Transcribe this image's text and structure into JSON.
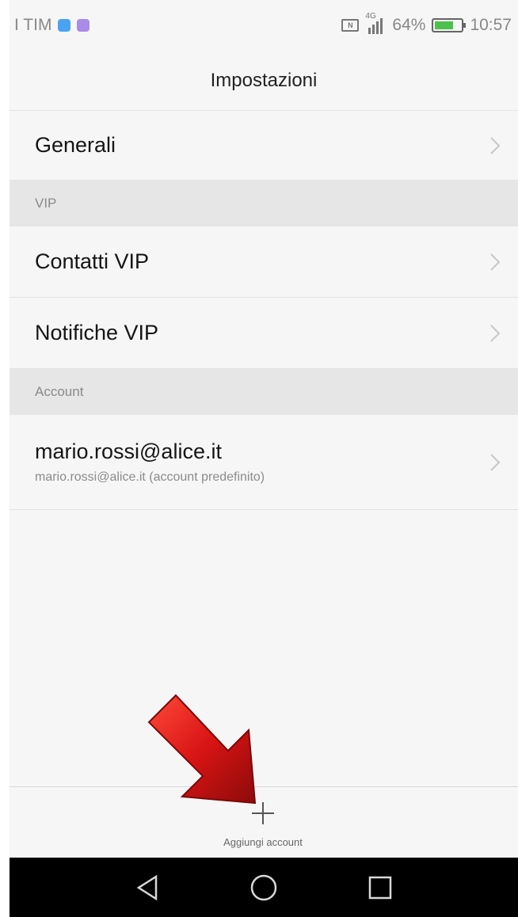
{
  "status_bar": {
    "carrier": "I TIM",
    "network": "4G",
    "battery_percent": "64%",
    "battery_level": 0.64,
    "time": "10:57",
    "icons": [
      "bluetooth-app-icon",
      "viber-app-icon",
      "nfc-icon",
      "signal-icon",
      "battery-icon"
    ]
  },
  "title": "Impostazioni",
  "items": {
    "general": "Generali",
    "vip_section": "VIP",
    "vip_contacts": "Contatti VIP",
    "vip_notifications": "Notifiche VIP",
    "account_section": "Account",
    "account_name": "mario.rossi@alice.it",
    "account_sub": "mario.rossi@alice.it (account predefinito)"
  },
  "bottom_bar": {
    "add_account_label": "Aggiungi account"
  },
  "nav": {
    "icons": [
      "back-icon",
      "home-icon",
      "recents-icon"
    ]
  },
  "colors": {
    "background": "#f6f6f6",
    "section_header_bg": "#e6e6e6",
    "arrow_red": "#d81414",
    "battery_green": "#4cc24c"
  }
}
